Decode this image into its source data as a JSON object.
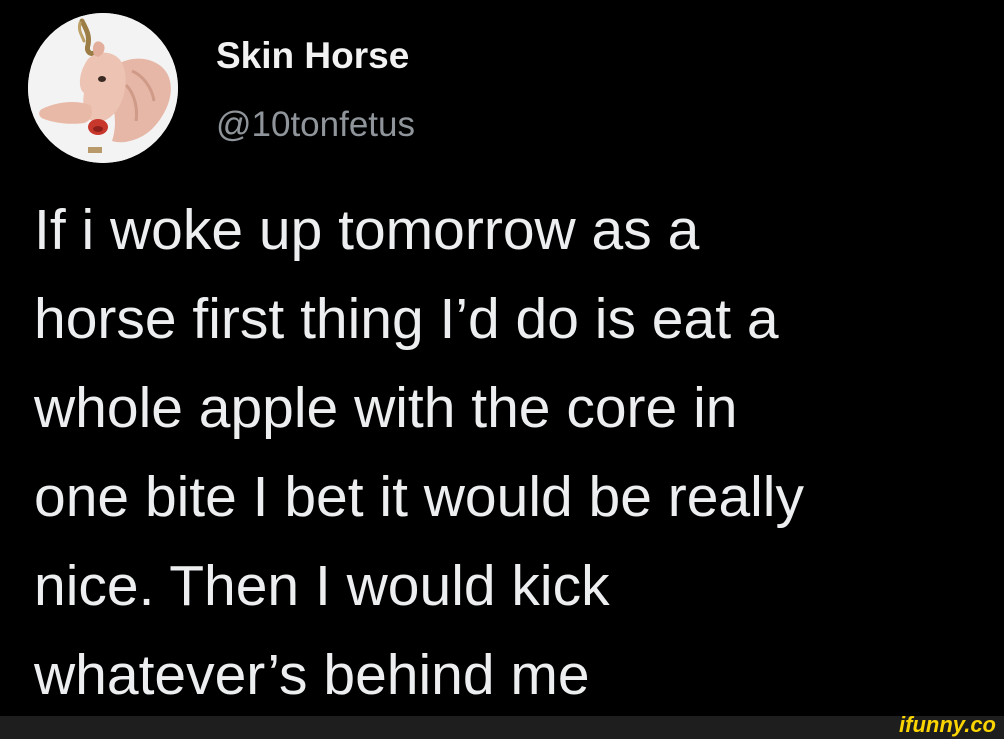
{
  "tweet": {
    "author": {
      "display_name": "Skin Horse",
      "handle": "@10tonfetus",
      "avatar_icon": "hairless-creature-avatar"
    },
    "text_lines": [
      "If i woke up tomorrow as a",
      "horse first thing I’d do is eat a",
      "whole apple with the core in",
      "one bite I bet it would be really",
      "nice. Then I would kick",
      "whatever’s behind me"
    ]
  },
  "watermark": {
    "text": "ifunny.co",
    "color": "#fbd501"
  },
  "colors": {
    "background": "#000000",
    "text": "#e7e9ea",
    "handle": "#8f959a",
    "footer_bar": "#1e1e1e"
  }
}
